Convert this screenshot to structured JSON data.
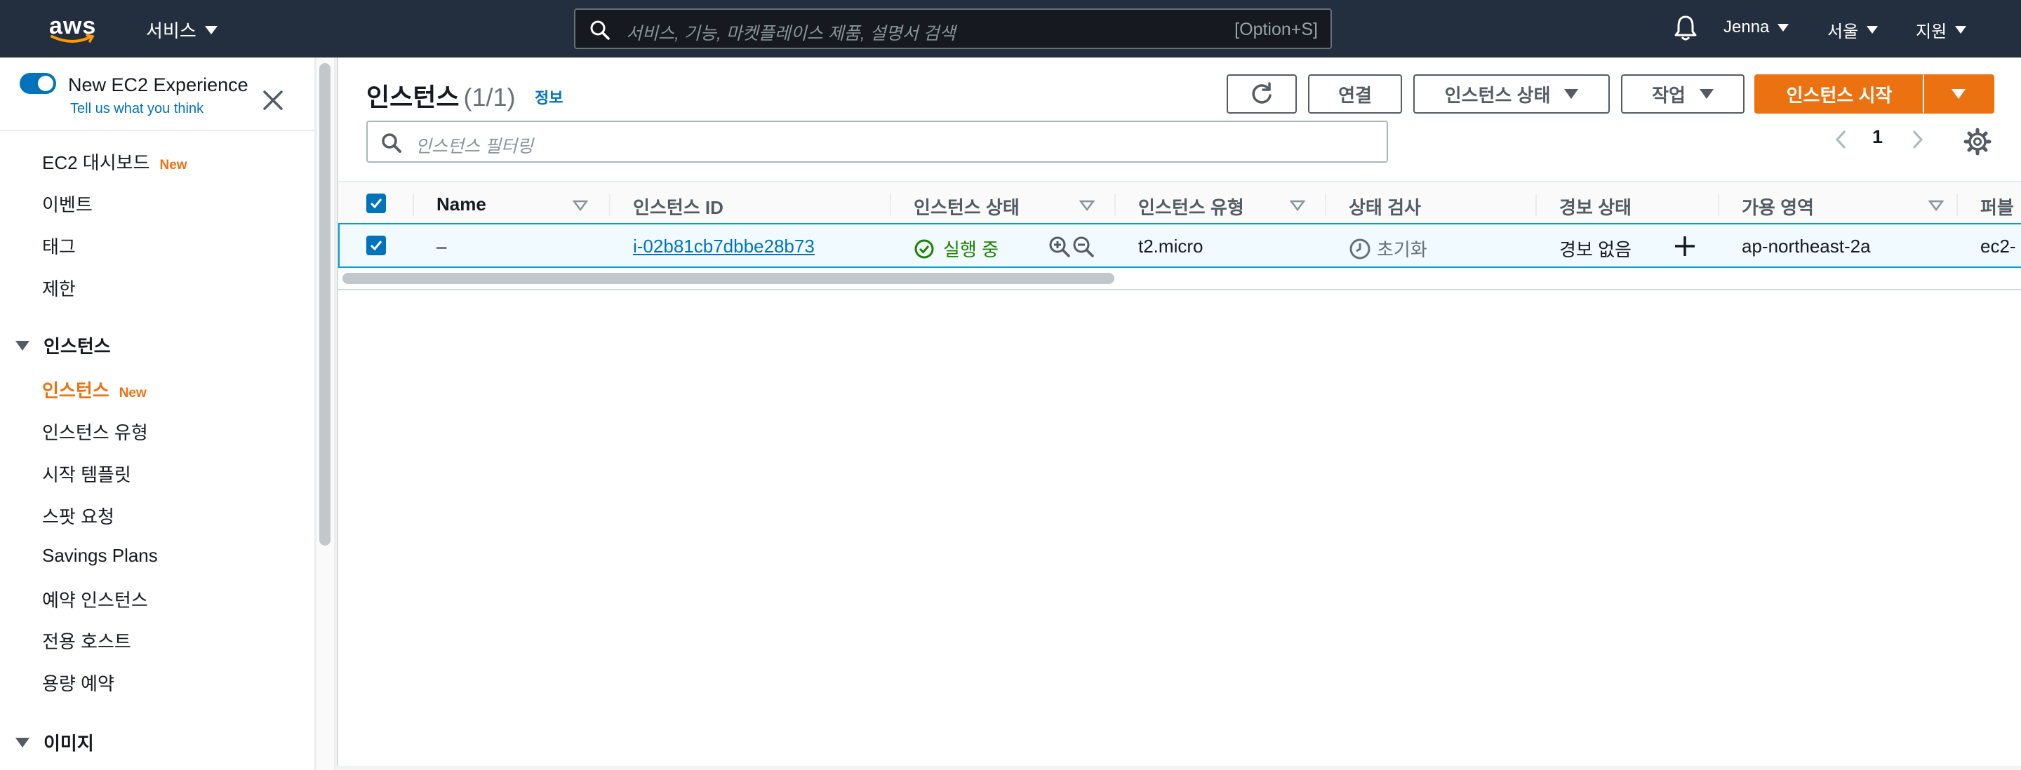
{
  "topnav": {
    "logo": "aws",
    "services_label": "서비스",
    "search_placeholder": "서비스, 기능, 마켓플레이스 제품, 설명서 검색",
    "search_shortcut": "[Option+S]",
    "user": "Jenna",
    "region": "서울",
    "support": "지원"
  },
  "sidebar": {
    "experience_title": "New EC2 Experience",
    "experience_link": "Tell us what you think",
    "items": [
      {
        "label": "EC2 대시보드",
        "badge": "New"
      },
      {
        "label": "이벤트"
      },
      {
        "label": "태그"
      },
      {
        "label": "제한"
      }
    ],
    "section_instances": "인스턴스",
    "instance_items": [
      {
        "label": "인스턴스",
        "badge": "New",
        "active": true
      },
      {
        "label": "인스턴스 유형"
      },
      {
        "label": "시작 템플릿"
      },
      {
        "label": "스팟 요청"
      },
      {
        "label": "Savings Plans"
      },
      {
        "label": "예약 인스턴스"
      },
      {
        "label": "전용 호스트"
      },
      {
        "label": "용량 예약"
      }
    ],
    "section_images": "이미지"
  },
  "main": {
    "title": "인스턴스",
    "count": "(1/1)",
    "info": "정보",
    "buttons": {
      "connect": "연결",
      "instance_state": "인스턴스 상태",
      "actions": "작업",
      "launch": "인스턴스 시작"
    },
    "filter_placeholder": "인스턴스 필터링",
    "page": "1",
    "columns": [
      "Name",
      "인스턴스 ID",
      "인스턴스 상태",
      "인스턴스 유형",
      "상태 검사",
      "경보 상태",
      "가용 영역",
      "퍼블릭"
    ],
    "rows": [
      {
        "name": "–",
        "instance_id": "i-02b81cb7dbbe28b73",
        "state": "실행 중",
        "type": "t2.micro",
        "status_check": "초기화",
        "alarm": "경보 없음",
        "az": "ap-northeast-2a",
        "public": "ec2-"
      }
    ]
  },
  "colors": {
    "nav_bg": "#232f3e",
    "accent_orange": "#ec7211",
    "link_blue": "#0073bb",
    "success_green": "#1d8102"
  }
}
